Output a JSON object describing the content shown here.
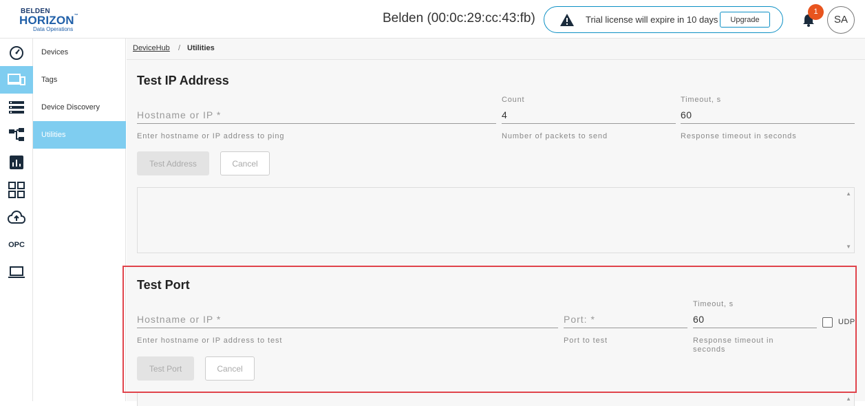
{
  "header": {
    "logo": {
      "line1": "BELDEN",
      "line2": "HORIZON",
      "tm": "™",
      "line3": "Data Operations"
    },
    "device_title": "Belden (00:0c:29:cc:43:fb)",
    "trial_text": "Trial license will expire in 10 days",
    "upgrade_label": "Upgrade",
    "notification_count": "1",
    "avatar_initials": "SA"
  },
  "rail": {
    "items": [
      "dashboard-icon",
      "devices-icon",
      "list-icon",
      "hierarchy-icon",
      "chart-icon",
      "apps-icon",
      "cloud-upload-icon",
      "opc",
      "laptop-icon"
    ],
    "opc_label": "OPC",
    "active_index": 1
  },
  "subnav": {
    "items": [
      {
        "label": "Devices"
      },
      {
        "label": "Tags"
      },
      {
        "label": "Device Discovery"
      },
      {
        "label": "Utilities"
      }
    ],
    "active_index": 3
  },
  "breadcrumb": {
    "root": "DeviceHub",
    "separator": "/",
    "current": "Utilities"
  },
  "test_ip": {
    "title": "Test IP Address",
    "hostname_placeholder": "Hostname or IP *",
    "hostname_hint": "Enter hostname or IP address to ping",
    "count_label": "Count",
    "count_value": "4",
    "count_hint": "Number of packets to send",
    "timeout_label": "Timeout, s",
    "timeout_value": "60",
    "timeout_hint": "Response timeout in seconds",
    "test_button": "Test Address",
    "cancel_button": "Cancel"
  },
  "test_port": {
    "title": "Test Port",
    "hostname_placeholder": "Hostname or IP *",
    "hostname_hint": "Enter hostname or IP address to test",
    "port_placeholder": "Port: *",
    "port_hint": "Port to test",
    "timeout_label": "Timeout, s",
    "timeout_value": "60",
    "timeout_hint": "Response timeout in seconds",
    "udp_label": "UDP",
    "test_button": "Test Port",
    "cancel_button": "Cancel"
  },
  "colors": {
    "accent": "#7fcdf0",
    "border_accent": "#0b8fc4",
    "badge": "#e8541e",
    "highlight": "#e0434b"
  }
}
